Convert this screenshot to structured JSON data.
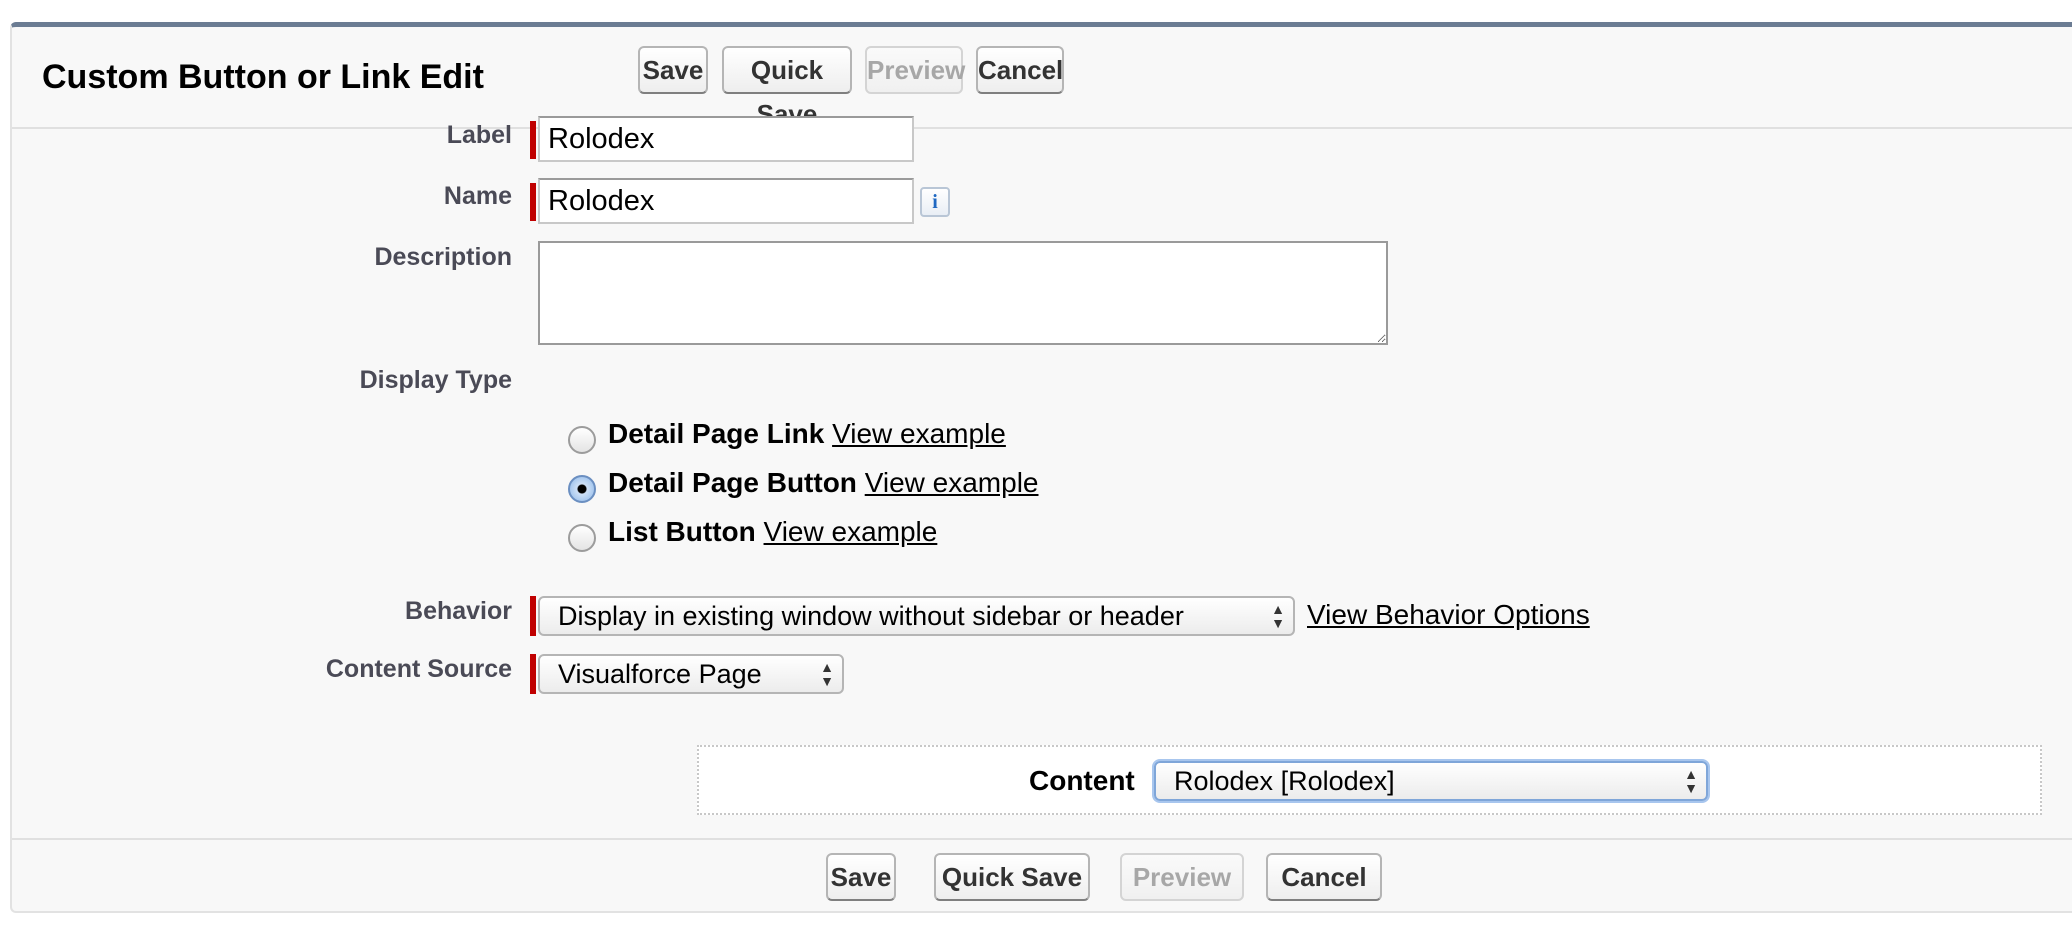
{
  "page": {
    "title": "Custom Button or Link Edit"
  },
  "buttons": {
    "save": "Save",
    "quick_save": "Quick Save",
    "preview": "Preview",
    "cancel": "Cancel"
  },
  "form": {
    "label": {
      "label": "Label",
      "value": "Rolodex"
    },
    "name": {
      "label": "Name",
      "value": "Rolodex",
      "info_icon": "info-icon"
    },
    "description": {
      "label": "Description",
      "value": ""
    },
    "display_type": {
      "label": "Display Type",
      "selected": "Detail Page Button",
      "options": [
        {
          "label": "Detail Page Link",
          "link": "View example",
          "checked": false
        },
        {
          "label": "Detail Page Button",
          "link": "View example",
          "checked": true
        },
        {
          "label": "List Button",
          "link": "View example",
          "checked": false
        }
      ]
    },
    "behavior": {
      "label": "Behavior",
      "value": "Display in existing window without sidebar or header",
      "link": "View Behavior Options"
    },
    "content_source": {
      "label": "Content Source",
      "value": "Visualforce Page"
    },
    "content": {
      "label": "Content",
      "value": "Rolodex [Rolodex]"
    }
  },
  "colors": {
    "required_bar": "#c00000",
    "panel_top_border": "#6b7c93",
    "focus_ring": "#7fa6d9"
  }
}
